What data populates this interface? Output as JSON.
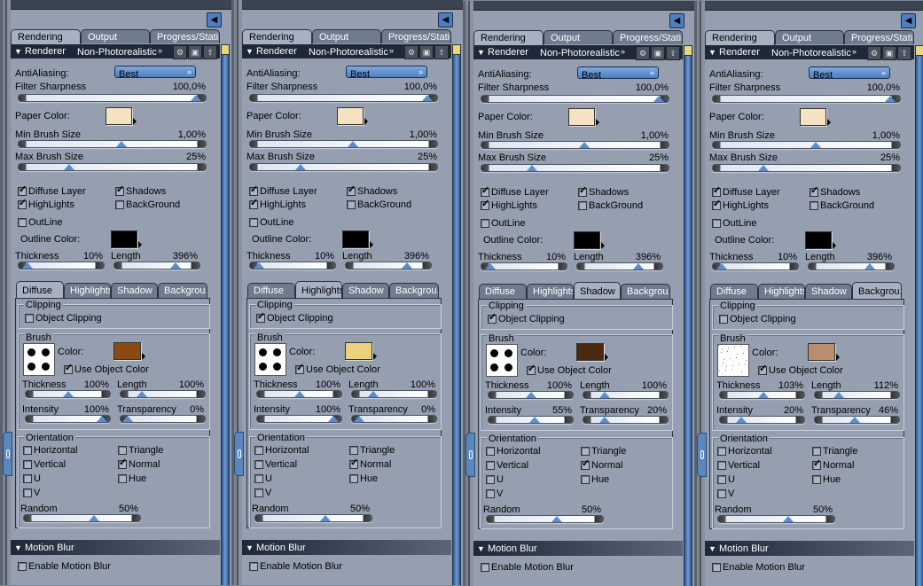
{
  "labels": {
    "tabs": [
      "Rendering",
      "Output",
      "Progress/Statist."
    ],
    "renderer_header": "Renderer",
    "renderer_value": "Non-Photorealistic",
    "antialiasing_label": "AntiAliasing:",
    "antialiasing_value": "Best",
    "filter_sharpness_label": "Filter Sharpness",
    "paper_color_label": "Paper Color:",
    "min_brush_label": "Min Brush Size",
    "max_brush_label": "Max Brush Size",
    "diffuse_layer": "Diffuse Layer",
    "shadows": "Shadows",
    "highlights": "HighLights",
    "background": "BackGround",
    "outline": "OutLine",
    "outline_color_label": "Outline Color:",
    "thickness": "Thickness",
    "length": "Length",
    "subtabs": [
      "Diffuse",
      "Highlights",
      "Shadow",
      "Backgrou."
    ],
    "clipping": "Clipping",
    "object_clipping": "Object Clipping",
    "brush": "Brush",
    "color_label": "Color:",
    "use_object_color": "Use Object Color",
    "intensity": "Intensity",
    "transparency": "Transparency",
    "orientation": "Orientation",
    "horizontal": "Horizontal",
    "triangle": "Triangle",
    "vertical": "Vertical",
    "normal": "Normal",
    "u": "U",
    "hue": "Hue",
    "v": "V",
    "random": "Random",
    "motion_blur": "Motion Blur",
    "enable_motion_blur": "Enable Motion Blur"
  },
  "settings": {
    "filter_sharpness": "100,0%",
    "filter_sharpness_pos": 0.95,
    "paper_color": "#f5e2c3",
    "min_brush": "1,00%",
    "min_brush_pos": 0.55,
    "max_brush": "25%",
    "max_brush_pos": 0.27,
    "diffuse_layer": true,
    "shadows": true,
    "highlights": true,
    "background": false,
    "outline": false,
    "outline_color": "#000000",
    "outline_thickness": "10%",
    "outline_thickness_pos": 0.1,
    "outline_length": "396%",
    "outline_length_pos": 0.72,
    "motion_blur": false
  },
  "panels": [
    {
      "active_subtab": 0,
      "object_clipping": false,
      "brush_color": "#8b4a14",
      "brush_preview": "dots",
      "thickness": "100%",
      "thickness_pos": 0.5,
      "length": "100%",
      "length_pos": 0.25,
      "intensity": "100%",
      "intensity_pos": 0.9,
      "transparency": "0%",
      "transparency_pos": 0.08,
      "orientation": {
        "horizontal": false,
        "triangle": false,
        "vertical": false,
        "normal": true,
        "u": false,
        "hue": false,
        "v": false
      },
      "random": "50%",
      "random_pos": 0.6
    },
    {
      "active_subtab": 1,
      "object_clipping": true,
      "brush_color": "#ecd17c",
      "brush_preview": "dots",
      "thickness": "100%",
      "thickness_pos": 0.5,
      "length": "100%",
      "length_pos": 0.25,
      "intensity": "100%",
      "intensity_pos": 0.9,
      "transparency": "0%",
      "transparency_pos": 0.08,
      "orientation": {
        "horizontal": false,
        "triangle": false,
        "vertical": false,
        "normal": true,
        "u": false,
        "hue": false,
        "v": false
      },
      "random": "50%",
      "random_pos": 0.6
    },
    {
      "active_subtab": 2,
      "object_clipping": true,
      "brush_color": "#4a2a10",
      "brush_preview": "dots",
      "thickness": "100%",
      "thickness_pos": 0.5,
      "length": "100%",
      "length_pos": 0.25,
      "intensity": "55%",
      "intensity_pos": 0.55,
      "transparency": "20%",
      "transparency_pos": 0.25,
      "orientation": {
        "horizontal": false,
        "triangle": false,
        "vertical": false,
        "normal": true,
        "u": false,
        "hue": false,
        "v": false
      },
      "random": "50%",
      "random_pos": 0.6
    },
    {
      "active_subtab": 3,
      "object_clipping": false,
      "brush_color": "#b88e6e",
      "brush_preview": "noise",
      "thickness": "103%",
      "thickness_pos": 0.52,
      "length": "112%",
      "length_pos": 0.28,
      "intensity": "20%",
      "intensity_pos": 0.25,
      "transparency": "46%",
      "transparency_pos": 0.47,
      "orientation": {
        "horizontal": false,
        "triangle": false,
        "vertical": false,
        "normal": true,
        "u": false,
        "hue": false,
        "v": false
      },
      "random": "50%",
      "random_pos": 0.6
    }
  ]
}
